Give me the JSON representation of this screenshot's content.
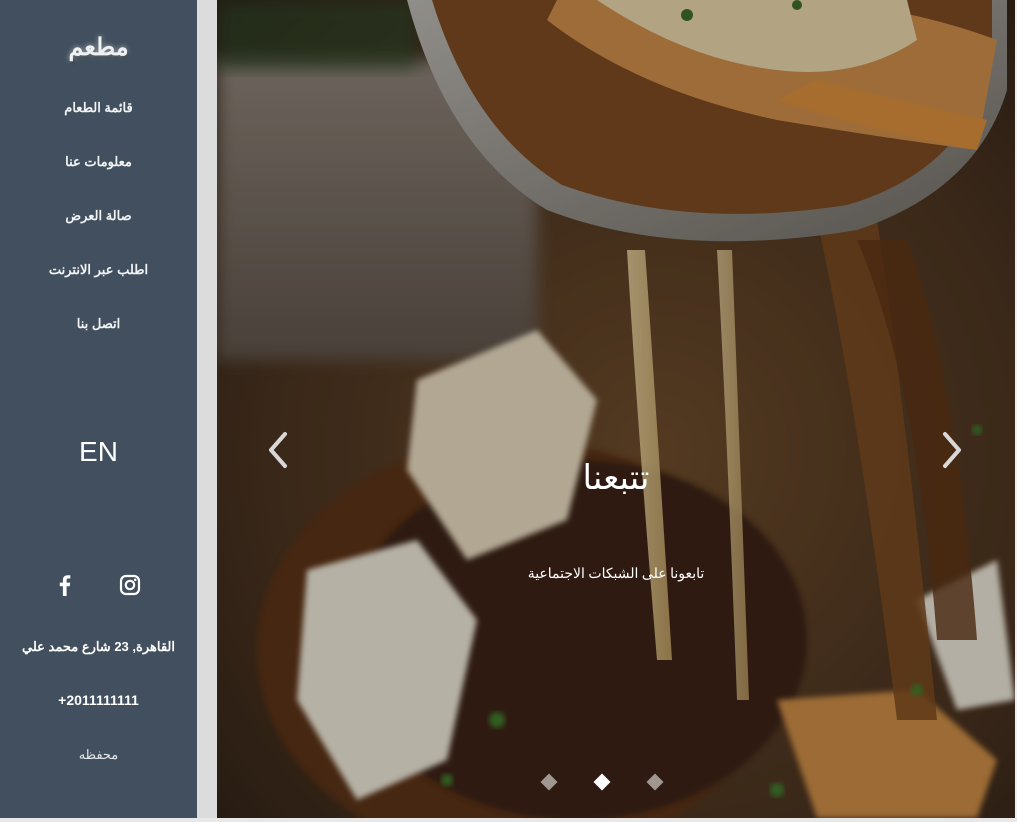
{
  "sidebar": {
    "logo": "مطعم",
    "nav": [
      {
        "label": "قائمة الطعام"
      },
      {
        "label": "معلومات عنا"
      },
      {
        "label": "صالة العرض"
      },
      {
        "label": "اطلب عبر الانترنت"
      },
      {
        "label": "اتصل بنا"
      }
    ],
    "language_toggle": "EN",
    "social": [
      {
        "icon": "facebook-icon"
      },
      {
        "icon": "instagram-icon"
      }
    ],
    "address": "القاهرة, 23 شارع محمد علي",
    "phone": "+2011111111",
    "wallet_link": "محفظه"
  },
  "carousel": {
    "slide_title": "تتبعنا",
    "slide_text": "تابعونا على الشبكات الاجتماعية",
    "prev_icon": "chevron-left-icon",
    "next_icon": "chevron-right-icon",
    "indicators": [
      {
        "active": false
      },
      {
        "active": true
      },
      {
        "active": false
      }
    ]
  },
  "colors": {
    "sidebar_bg": "#414f5e",
    "text": "#ffffff"
  }
}
